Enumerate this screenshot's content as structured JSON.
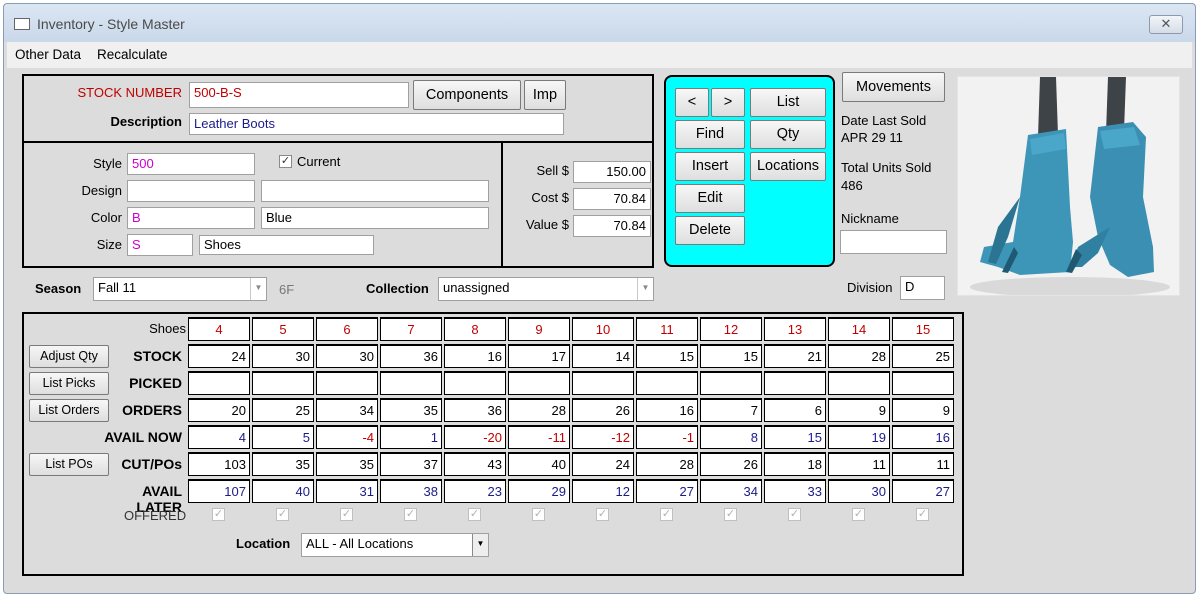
{
  "window": {
    "title": "Inventory - Style Master",
    "close_glyph": "✕"
  },
  "menu": {
    "items": [
      "Other Data",
      "Recalculate"
    ]
  },
  "header": {
    "stock_number_label": "STOCK NUMBER",
    "stock_number_value": "500-B-S",
    "components_label": "Components",
    "imp_label": "Imp",
    "description_label": "Description",
    "description_value": "Leather Boots"
  },
  "attributes": {
    "style_label": "Style",
    "style_value": "500",
    "current_label": "Current",
    "current_checked": true,
    "design_label": "Design",
    "design_code": "",
    "design_desc": "",
    "color_label": "Color",
    "color_code": "B",
    "color_desc": "Blue",
    "size_label": "Size",
    "size_code": "S",
    "size_desc": "Shoes"
  },
  "pricing": {
    "sell_label": "Sell $",
    "sell_value": "150.00",
    "cost_label": "Cost $",
    "cost_value": "70.84",
    "value_label": "Value $",
    "value_value": "70.84"
  },
  "nav": {
    "prev": "<",
    "next": ">",
    "list": "List",
    "find": "Find",
    "qty": "Qty",
    "insert": "Insert",
    "locations": "Locations",
    "edit": "Edit",
    "delete": "Delete"
  },
  "info": {
    "movements_label": "Movements",
    "date_last_sold_label": "Date Last Sold",
    "date_last_sold_value": "APR 29 11",
    "total_units_label": "Total Units Sold",
    "total_units_value": "486",
    "nickname_label": "Nickname",
    "nickname_value": "",
    "division_label": "Division",
    "division_value": "D"
  },
  "season": {
    "label": "Season",
    "value": "Fall 11",
    "code": "6F"
  },
  "collection": {
    "label": "Collection",
    "value": "unassigned"
  },
  "grid": {
    "size_header": "Shoes",
    "sizes": [
      "4",
      "5",
      "6",
      "7",
      "8",
      "9",
      "10",
      "11",
      "12",
      "13",
      "14",
      "15"
    ],
    "rows": [
      {
        "label": "STOCK",
        "button": "Adjust Qty",
        "values": [
          "24",
          "30",
          "30",
          "36",
          "16",
          "17",
          "14",
          "15",
          "15",
          "21",
          "28",
          "25"
        ]
      },
      {
        "label": "PICKED",
        "button": "List Picks",
        "values": [
          "",
          "",
          "",
          "",
          "",
          "",
          "",
          "",
          "",
          "",
          "",
          ""
        ]
      },
      {
        "label": "ORDERS",
        "button": "List Orders",
        "values": [
          "20",
          "25",
          "34",
          "35",
          "36",
          "28",
          "26",
          "16",
          "7",
          "6",
          "9",
          "9"
        ]
      },
      {
        "label": "AVAIL NOW",
        "button": "",
        "values": [
          "4",
          "5",
          "-4",
          "1",
          "-20",
          "-11",
          "-12",
          "-1",
          "8",
          "15",
          "19",
          "16"
        ]
      },
      {
        "label": "CUT/POs",
        "button": "List POs",
        "values": [
          "103",
          "35",
          "35",
          "37",
          "43",
          "40",
          "24",
          "28",
          "26",
          "18",
          "11",
          "11"
        ]
      },
      {
        "label": "AVAIL LATER",
        "button": "",
        "values": [
          "107",
          "40",
          "31",
          "38",
          "23",
          "29",
          "12",
          "27",
          "34",
          "33",
          "30",
          "27"
        ]
      }
    ],
    "offered_label": "OFFERED",
    "offered": [
      true,
      true,
      true,
      true,
      true,
      true,
      true,
      true,
      true,
      true,
      true,
      true
    ]
  },
  "location": {
    "label": "Location",
    "value": "ALL - All Locations"
  },
  "colors": {
    "red": "#c00000",
    "blue": "#1a1a8c",
    "magenta": "#cc00cc",
    "cyan": "#00ffff"
  }
}
